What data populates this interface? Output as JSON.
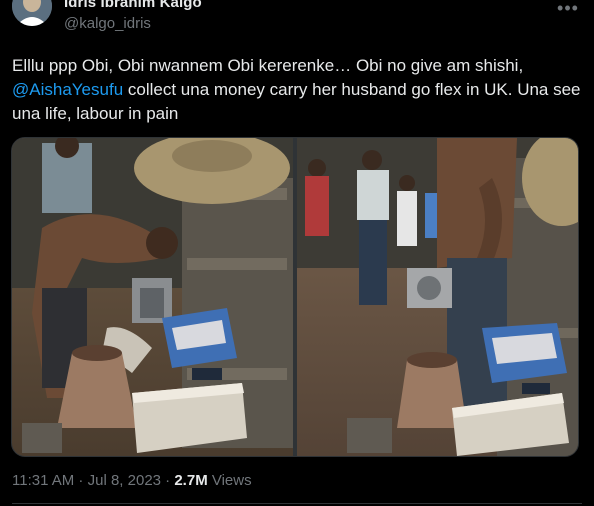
{
  "author": {
    "name": "Idris Ibrahim Kalgo",
    "handle": "@kalgo_idris"
  },
  "tweet": {
    "text_before": "Elllu ppp Obi, Obi nwannem Obi kererenke… Obi no give am shishi, ",
    "mention": "@AishaYesufu",
    "text_after": " collect una money carry her husband go flex in UK. Una see una life, labour in pain"
  },
  "media": {
    "photos": [
      "photo-left",
      "photo-right"
    ]
  },
  "meta": {
    "time": "11:31 AM",
    "separator": " · ",
    "date": "Jul 8, 2023",
    "views_count": "2.7M",
    "views_label": " Views"
  },
  "icons": {
    "more": "more-horizontal-icon"
  }
}
